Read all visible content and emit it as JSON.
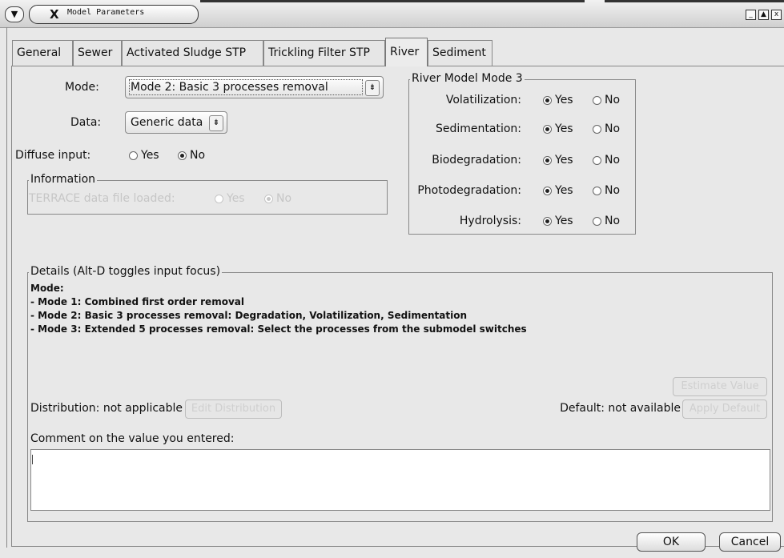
{
  "window": {
    "title": "Model Parameters",
    "menu_glyph": "▼",
    "logo_glyph": "X",
    "min_glyph": "_",
    "max_glyph": "▲",
    "close_glyph": "x"
  },
  "tabs": [
    {
      "label": "General"
    },
    {
      "label": "Sewer"
    },
    {
      "label": "Activated Sludge STP"
    },
    {
      "label": "Trickling Filter STP"
    },
    {
      "label": "River",
      "active": true
    },
    {
      "label": "Sediment"
    }
  ],
  "form": {
    "mode_label": "Mode:",
    "mode_value": "Mode 2: Basic 3 processes removal",
    "data_label": "Data:",
    "data_value": "Generic data",
    "combo_arrow": "⇟",
    "diffuse_label": "Diffuse input:",
    "diffuse_yes": "Yes",
    "diffuse_no": "No",
    "diffuse_selected": "No"
  },
  "information": {
    "title": "Information",
    "terrace_label": "TERRACE data file loaded:",
    "yes": "Yes",
    "no": "No",
    "selected": "No"
  },
  "river_model": {
    "title": "River Model Mode 3",
    "yes": "Yes",
    "no": "No",
    "rows": [
      {
        "label": "Volatilization:",
        "selected": "Yes"
      },
      {
        "label": "Sedimentation:",
        "selected": "Yes"
      },
      {
        "label": "Biodegradation:",
        "selected": "Yes"
      },
      {
        "label": "Photodegradation:",
        "selected": "Yes"
      },
      {
        "label": "Hydrolysis:",
        "selected": "Yes"
      }
    ]
  },
  "details": {
    "title": "Details (Alt-D toggles input focus)",
    "lines": [
      "Mode:",
      "- Mode 1: Combined first order removal",
      "- Mode 2: Basic 3 processes removal: Degradation, Volatilization, Sedimentation",
      "- Mode 3: Extended 5 processes removal: Select the processes from the submodel switches"
    ],
    "estimate_button": "Estimate Value",
    "distribution_text": "Distribution: not applicable",
    "edit_distribution_button": "Edit Distribution",
    "default_text": "Default: not available",
    "apply_default_button": "Apply Default",
    "comment_label": "Comment on the value you entered:",
    "comment_value": ""
  },
  "footer": {
    "ok": "OK",
    "cancel": "Cancel"
  }
}
